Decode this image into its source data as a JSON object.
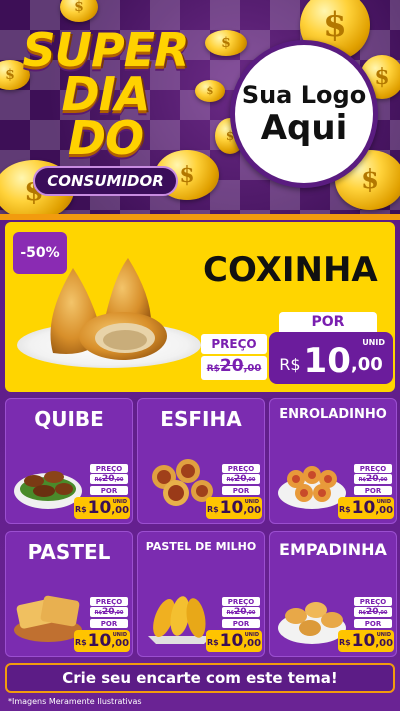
{
  "header": {
    "title_line1": "SUPER",
    "title_line2": "DIA DO",
    "subtitle": "CONSUMIDOR",
    "logo_line1": "Sua Logo",
    "logo_line2": "Aqui"
  },
  "hero": {
    "discount": "-50%",
    "name": "COXINHA",
    "preco_label": "PREÇO",
    "old_price_currency": "R$",
    "old_price_int": "20",
    "old_price_cents": ",00",
    "por_label": "POR",
    "price_currency": "R$",
    "price_int": "10",
    "price_cents": ",00",
    "unit": "UNID"
  },
  "products": [
    {
      "name": "QUIBE",
      "preco_label": "PREÇO",
      "old_currency": "R$",
      "old_int": "20",
      "old_cents": ",00",
      "por_label": "POR",
      "currency": "R$",
      "int": "10",
      "cents": ",00",
      "unit": "UNID"
    },
    {
      "name": "ESFIHA",
      "preco_label": "PREÇO",
      "old_currency": "R$",
      "old_int": "20",
      "old_cents": ",00",
      "por_label": "POR",
      "currency": "R$",
      "int": "10",
      "cents": ",00",
      "unit": "UNID"
    },
    {
      "name": "ENROLADINHO",
      "preco_label": "PREÇO",
      "old_currency": "R$",
      "old_int": "20",
      "old_cents": ",00",
      "por_label": "POR",
      "currency": "R$",
      "int": "10",
      "cents": ",00",
      "unit": "UNID"
    },
    {
      "name": "PASTEL",
      "preco_label": "PREÇO",
      "old_currency": "R$",
      "old_int": "20",
      "old_cents": ",00",
      "por_label": "POR",
      "currency": "R$",
      "int": "10",
      "cents": ",00",
      "unit": "UNID"
    },
    {
      "name": "PASTEL DE MILHO",
      "preco_label": "PREÇO",
      "old_currency": "R$",
      "old_int": "20",
      "old_cents": ",00",
      "por_label": "POR",
      "currency": "R$",
      "int": "10",
      "cents": ",00",
      "unit": "UNID"
    },
    {
      "name": "EMPADINHA",
      "preco_label": "PREÇO",
      "old_currency": "R$",
      "old_int": "20",
      "old_cents": ",00",
      "por_label": "POR",
      "currency": "R$",
      "int": "10",
      "cents": ",00",
      "unit": "UNID"
    }
  ],
  "footer": {
    "cta": "Crie seu encarte com este tema!",
    "note": "*Imagens Meramente Ilustrativas"
  },
  "colors": {
    "purple": "#6b1c9c",
    "yellow": "#ffd500",
    "orange": "#f29b0e",
    "gold": "#ffc400"
  },
  "icons": [
    "coin-icon"
  ]
}
